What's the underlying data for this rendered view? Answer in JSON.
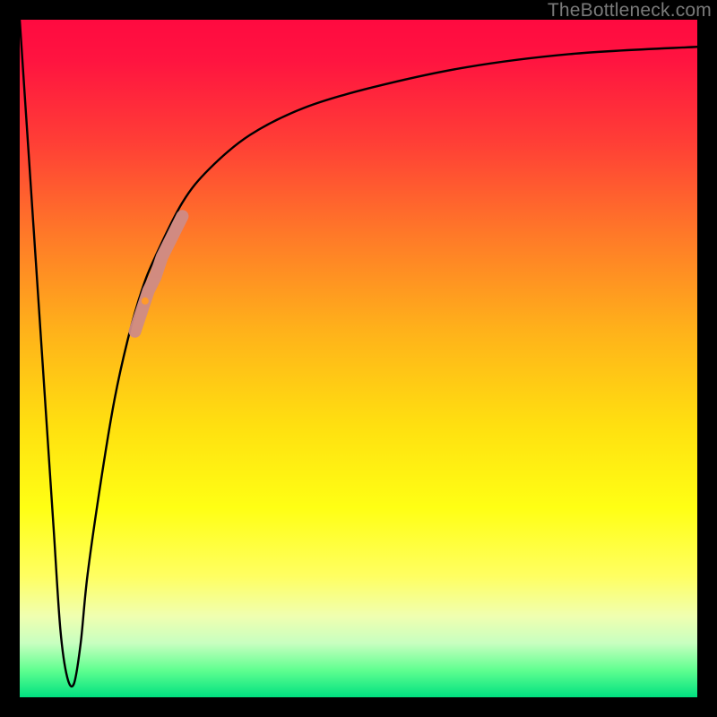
{
  "watermark": "TheBottleneck.com",
  "chart_data": {
    "type": "line",
    "title": "",
    "xlabel": "",
    "ylabel": "",
    "xlim": [
      0,
      100
    ],
    "ylim": [
      0,
      100
    ],
    "series": [
      {
        "name": "bottleneck-curve",
        "x": [
          0,
          2,
          4,
          5,
          6,
          7,
          8,
          9,
          10,
          12,
          14,
          16,
          18,
          20,
          24,
          28,
          34,
          42,
          52,
          66,
          82,
          100
        ],
        "y": [
          100,
          70,
          40,
          25,
          10,
          3,
          2,
          8,
          18,
          32,
          44,
          53,
          60,
          65,
          73,
          78,
          83,
          87,
          90,
          93,
          95,
          96
        ]
      }
    ],
    "highlight": {
      "name": "highlight-segment",
      "color": "#cf8b86",
      "x": [
        17,
        18,
        19,
        20,
        21,
        22,
        23,
        24
      ],
      "y": [
        54,
        57,
        60,
        62,
        65,
        67,
        69,
        71
      ]
    }
  }
}
